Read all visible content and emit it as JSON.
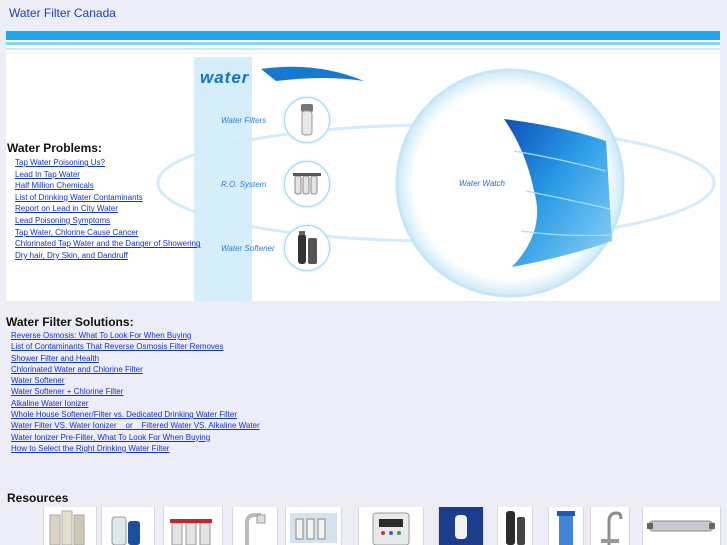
{
  "site": {
    "title": "Water Filter Canada"
  },
  "banner": {
    "logo_text": "water",
    "labels": {
      "water_filters": "Water Filters",
      "ro_system": "R.O. System",
      "water_softener": "Water Softener",
      "water_watch": "Water Watch"
    },
    "colors": {
      "top_bar": "#1fa6ec",
      "column": "#d6eefa",
      "ring": "#cfe9f8",
      "wave": "#1d86d8"
    }
  },
  "problems": {
    "heading": "Water Problems:",
    "links": [
      "Tap Water Poisoning Us?",
      "Lead In Tap Water",
      "Half Million Chemicals",
      "List of Drinking Water Contaminants",
      "Report on Lead in City Water",
      "Lead Poisoning Symptoms",
      "Tap Water, Chlorine Cause Cancer",
      "Chlorinated Tap Water and the Danger of Showering",
      "Dry hair, Dry Skin, and Dandruff"
    ]
  },
  "solutions": {
    "heading": "Water Filter Solutions:",
    "links": [
      "Reverse Osmosis: What To Look For When Buying",
      "List of Contaminants That Reverse Osmosis Filter Removes",
      "Shower Filter and Health",
      "Chlorinated Water and Chlorine Filter",
      "Water Softener",
      "Water Softener + Chlorine Filter",
      "Alkaline Water Ionizer",
      "Whole House Softener/Filter vs. Dedicated Drinking Water Filter",
      "Water Filter VS. Water Ionizer    or    Filtered Water VS. Alkaline Water",
      "Water Ionizer Pre-Filter, What To Look For When Buying",
      "How to Select the Right Drinking Water Filter"
    ]
  },
  "resources": {
    "heading": "Resources",
    "thumbnails": [
      "filter-cartridges-icon",
      "countertop-filter-icon",
      "triple-filter-icon",
      "faucet-filter-icon",
      "ro-system-icon",
      "water-ionizer-icon",
      "shower-filter-icon",
      "softener-tank-icon",
      "housing-filter-icon",
      "chrome-faucet-icon",
      "uv-lamp-icon"
    ]
  },
  "colors": {
    "link": "#1533c9",
    "title": "#1a3fb6",
    "background": "#ecedf7"
  }
}
